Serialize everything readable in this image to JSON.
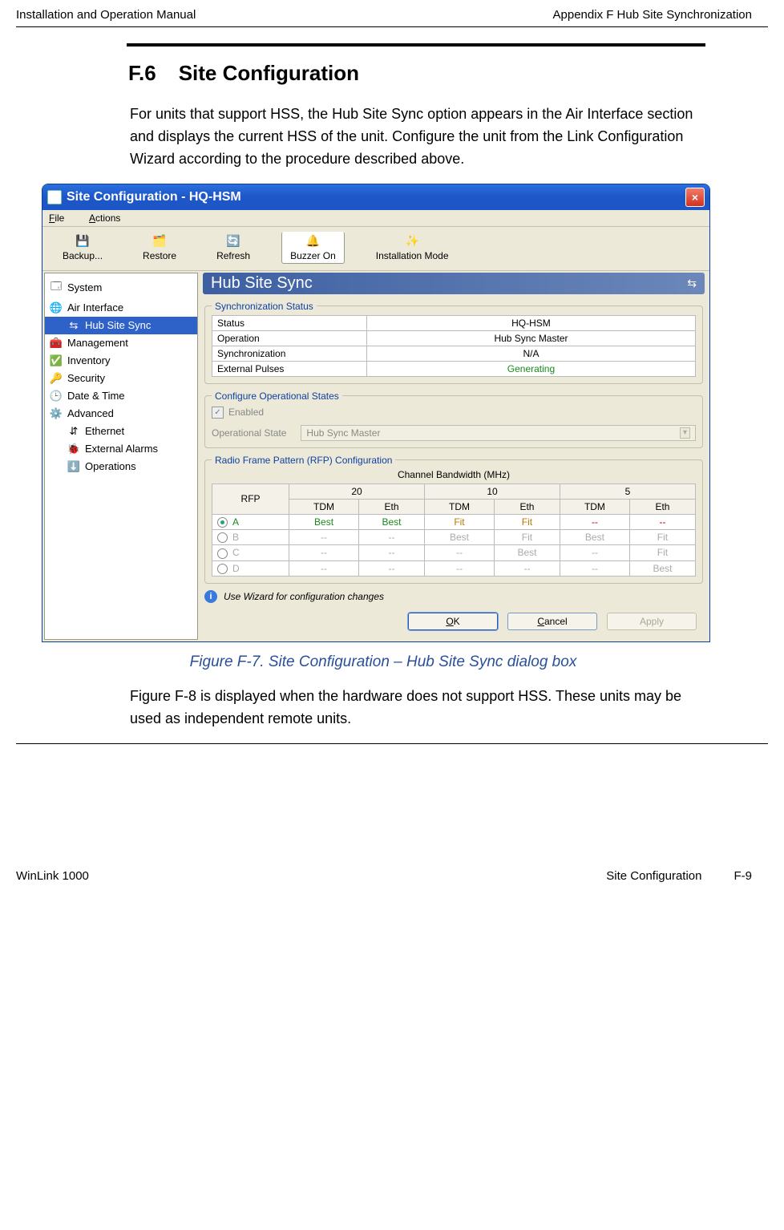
{
  "header": {
    "left": "Installation and Operation Manual",
    "right": "Appendix F  Hub Site Synchronization"
  },
  "section": {
    "number": "F.6",
    "title": "Site Configuration"
  },
  "paragraph1": "For units that support HSS, the Hub Site Sync option appears in the Air Interface section and displays the current HSS of the unit. Configure the unit from the Link Configuration Wizard according to the procedure described above.",
  "window": {
    "title": "Site Configuration - HQ-HSM",
    "menu": {
      "file": "File",
      "actions": "Actions"
    },
    "toolbar": {
      "backup": "Backup...",
      "restore": "Restore",
      "refresh": "Refresh",
      "buzzer": "Buzzer On",
      "install": "Installation Mode"
    },
    "sidebar": [
      "System",
      "Air Interface",
      "Hub Site Sync",
      "Management",
      "Inventory",
      "Security",
      "Date & Time",
      "Advanced",
      "Ethernet",
      "External Alarms",
      "Operations"
    ],
    "panel_title": "Hub Site Sync",
    "sync_status": {
      "legend": "Synchronization Status",
      "rows": {
        "status_k": "Status",
        "status_v": "HQ-HSM",
        "operation_k": "Operation",
        "operation_v": "Hub Sync Master",
        "sync_k": "Synchronization",
        "sync_v": "N/A",
        "pulses_k": "External Pulses",
        "pulses_v": "Generating"
      }
    },
    "op_states": {
      "legend": "Configure Operational States",
      "enabled": "Enabled",
      "op_state_label": "Operational State",
      "op_state_value": "Hub Sync Master"
    },
    "rfp": {
      "legend": "Radio Frame Pattern (RFP) Configuration",
      "cbw_label": "Channel Bandwidth (MHz)",
      "bw": [
        "20",
        "10",
        "5"
      ],
      "subcols": {
        "rfp": "RFP",
        "tdm": "TDM",
        "eth": "Eth"
      },
      "rows": [
        {
          "name": "A",
          "sel": true,
          "v": [
            "Best",
            "Best",
            "Fit",
            "Fit",
            "--",
            "--"
          ],
          "cls": [
            "g",
            "g",
            "o",
            "o",
            "r",
            "r"
          ]
        },
        {
          "name": "B",
          "sel": false,
          "v": [
            "--",
            "--",
            "Best",
            "Fit",
            "Best",
            "Fit"
          ],
          "cls": [
            "dim",
            "dim",
            "dim",
            "dim",
            "dim",
            "dim"
          ]
        },
        {
          "name": "C",
          "sel": false,
          "v": [
            "--",
            "--",
            "--",
            "Best",
            "--",
            "Fit"
          ],
          "cls": [
            "dim",
            "dim",
            "dim",
            "dim",
            "dim",
            "dim"
          ]
        },
        {
          "name": "D",
          "sel": false,
          "v": [
            "--",
            "--",
            "--",
            "--",
            "--",
            "Best"
          ],
          "cls": [
            "dim",
            "dim",
            "dim",
            "dim",
            "dim",
            "dim"
          ]
        }
      ]
    },
    "wizard_note": "Use Wizard for configuration changes",
    "buttons": {
      "ok": "OK",
      "cancel": "Cancel",
      "apply": "Apply"
    }
  },
  "figure_caption": "Figure F-7.  Site Configuration – Hub Site Sync dialog box",
  "paragraph2": "Figure F-8 is displayed when the hardware does not support HSS. These units may be used as independent remote units.",
  "footer": {
    "left": "WinLink 1000",
    "center": "Site Configuration",
    "right": "F-9"
  }
}
